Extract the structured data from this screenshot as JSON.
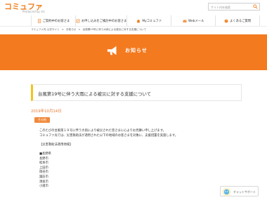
{
  "header": {
    "logo": "コミュファ",
    "logo_sub": "Produced by ctc",
    "search_placeholder": "サイト内を検索"
  },
  "nav": {
    "items": [
      {
        "label": "ご契約中のお客さま"
      },
      {
        "label": "お申し込みをご検討中のお客さま"
      },
      {
        "label": "Myコミュファ"
      },
      {
        "label": "Webメール"
      },
      {
        "label": "よくあるご質問"
      }
    ]
  },
  "breadcrumb": {
    "items": [
      "コミュファ光 公式サイト",
      "お知らせ",
      "台風第19号に伴う大雨による被災に対する支援について"
    ],
    "separator": ">"
  },
  "hero": {
    "title": "お知らせ"
  },
  "article": {
    "title": "台風第19号に伴う大雨による被災に対する支援について",
    "date": "2019年10月14日",
    "badge": "その他",
    "lines": [
      "このたびの台風第１９号に伴う大雨により被災された皆さまに心よりお見舞い申し上げます。",
      "コミュファ光では、災害救助法が適用された以下の地域のお客さまを対象に、支援措置を実施します。",
      "",
      "【災害救助法適用地域】",
      "",
      "■長野県",
      "長野市",
      "松本市",
      "上田市",
      "岡谷市",
      "諏訪市",
      "須坂市",
      "小諸市"
    ]
  },
  "chat": {
    "label": "チャットサポート"
  }
}
